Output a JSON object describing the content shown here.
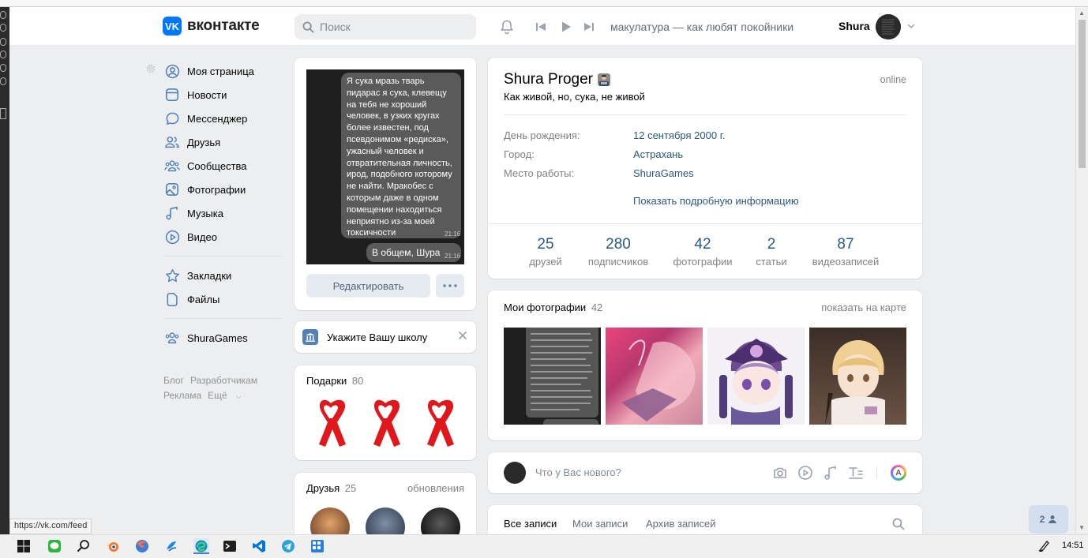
{
  "browser": {
    "status_url": "https://vk.com/feed",
    "clock": "14:51"
  },
  "header": {
    "logo_text": "вконтакте",
    "search_placeholder": "Поиск",
    "now_playing": "макулатура — как любят покойники",
    "user_name": "Shura"
  },
  "nav": {
    "items": [
      {
        "label": "Моя страница",
        "icon": "user-circle-icon"
      },
      {
        "label": "Новости",
        "icon": "news-icon"
      },
      {
        "label": "Мессенджер",
        "icon": "message-icon"
      },
      {
        "label": "Друзья",
        "icon": "friends-icon"
      },
      {
        "label": "Сообщества",
        "icon": "communities-icon"
      },
      {
        "label": "Фотографии",
        "icon": "photo-icon"
      },
      {
        "label": "Музыка",
        "icon": "music-icon"
      },
      {
        "label": "Видео",
        "icon": "video-icon"
      }
    ],
    "items2": [
      {
        "label": "Закладки",
        "icon": "star-icon"
      },
      {
        "label": "Файлы",
        "icon": "file-icon"
      }
    ],
    "groups": [
      {
        "label": "ShuraGames",
        "icon": "group-icon"
      }
    ],
    "footer": {
      "blog": "Блог",
      "developers": "Разработчикам",
      "ads": "Реклама",
      "more": "Ещё"
    }
  },
  "photo": {
    "bubble_text": "Я сука мразь тварь пидарас я сука, клевещу на тебя не хороший человек, в узких кругах более известен, под псевдонимом «редиска», ужасный человек и отвратительная личность, ирод, подобного которому не найти. Мракобес с которым даже в одном помещении находиться неприятно из-за моей токсичности",
    "bubble_time": "21:16",
    "bubble2_text": "В общем, Шура",
    "bubble2_time": "21:16",
    "edit_label": "Редактировать"
  },
  "school": {
    "label": "Укажите Вашу школу"
  },
  "gifts": {
    "title": "Подарки",
    "count": "80"
  },
  "friends": {
    "title": "Друзья",
    "count": "25",
    "updates": "обновления"
  },
  "profile": {
    "name": "Shura Proger",
    "status": "Как живой, но, сука, не живой",
    "online": "online",
    "info": [
      {
        "label": "День рождения:",
        "value": "12 сентября 2000 г."
      },
      {
        "label": "Город:",
        "value": "Астрахань"
      },
      {
        "label": "Место работы:",
        "value": "ShuraGames"
      }
    ],
    "more_info": "Показать подробную информацию",
    "counters": [
      {
        "value": "25",
        "label": "друзей"
      },
      {
        "value": "280",
        "label": "подписчиков"
      },
      {
        "value": "42",
        "label": "фотографии"
      },
      {
        "value": "2",
        "label": "статьи"
      },
      {
        "value": "87",
        "label": "видеозаписей"
      }
    ]
  },
  "photos": {
    "title": "Мои фотографии",
    "count": "42",
    "map_link": "показать на карте"
  },
  "post": {
    "placeholder": "Что у Вас нового?"
  },
  "wall": {
    "tabs": [
      "Все записи",
      "Мои записи",
      "Архив записей"
    ]
  },
  "chat_badge": "2",
  "colors": {
    "accent": "#2a5885",
    "brand": "#0077ff",
    "background": "#edeef0"
  }
}
